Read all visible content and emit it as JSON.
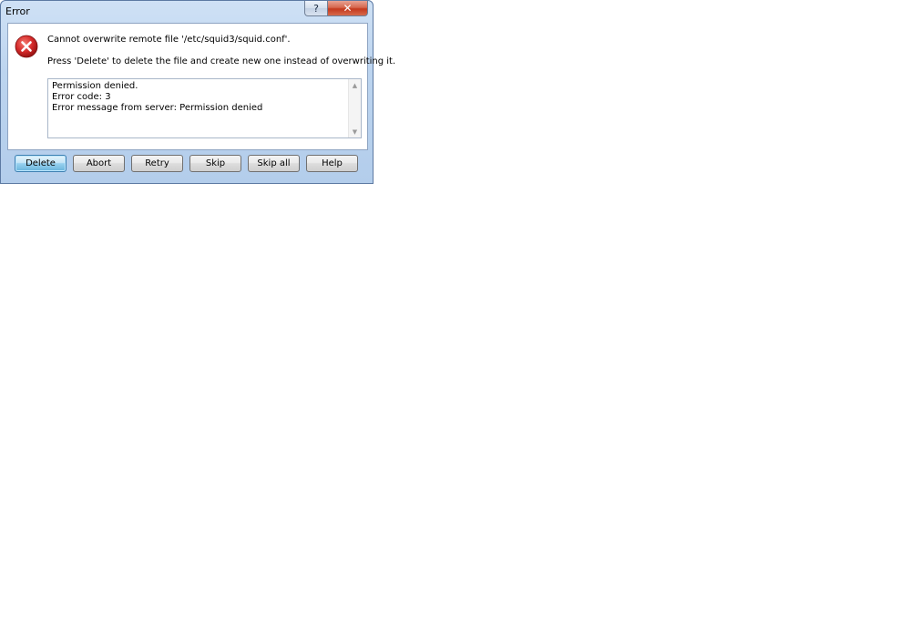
{
  "window": {
    "title": "Error",
    "help_glyph": "?",
    "close_glyph": "✕"
  },
  "message": {
    "line1": "Cannot overwrite remote file '/etc/squid3/squid.conf'.",
    "line2": "Press 'Delete' to delete the file and create new one instead of overwriting it."
  },
  "details": {
    "lines": [
      "Permission denied.",
      "Error code: 3",
      "Error message from server: Permission denied"
    ]
  },
  "buttons": {
    "delete": "Delete",
    "abort": "Abort",
    "retry": "Retry",
    "skip": "Skip",
    "skip_all": "Skip all",
    "help": "Help"
  },
  "icons": {
    "error": "error-icon",
    "help": "help-icon",
    "close": "close-icon"
  },
  "colors": {
    "error_red": "#c8102e",
    "close_button": "#c4391e",
    "default_button": "#98d1ef"
  }
}
